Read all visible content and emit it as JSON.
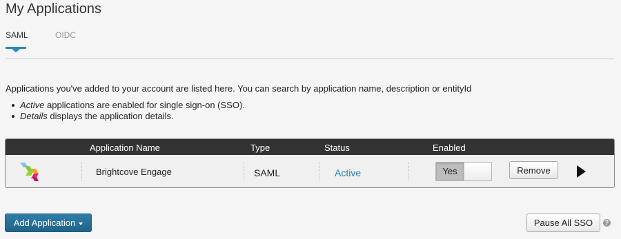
{
  "page": {
    "title": "My Applications"
  },
  "tabs": [
    {
      "label": "SAML",
      "active": true
    },
    {
      "label": "OIDC",
      "active": false
    }
  ],
  "intro": {
    "text": "Applications you've added to your account are listed here. You can search by application name, description or entityId",
    "bullets": [
      {
        "em": "Active",
        "rest": " applications are enabled for single sign-on (SSO)."
      },
      {
        "em": "Details",
        "rest": " displays the application details."
      }
    ]
  },
  "table": {
    "columns": [
      "Application Name",
      "Type",
      "Status",
      "Enabled"
    ],
    "rows": [
      {
        "logo_icon": "brightcove-logo-icon",
        "name": "Brightcove Engage",
        "type": "SAML",
        "status": "Active",
        "enabled_label": "Yes",
        "remove_label": "Remove",
        "details_icon": "play-arrow-icon"
      }
    ]
  },
  "actions": {
    "add_label": "Add Application",
    "pause_label": "Pause All SSO",
    "help_glyph": "?"
  },
  "colors": {
    "accent": "#2f87b5",
    "link": "#1f7fb8",
    "header_bg": "#333333",
    "primary_button": "#2470a0"
  }
}
